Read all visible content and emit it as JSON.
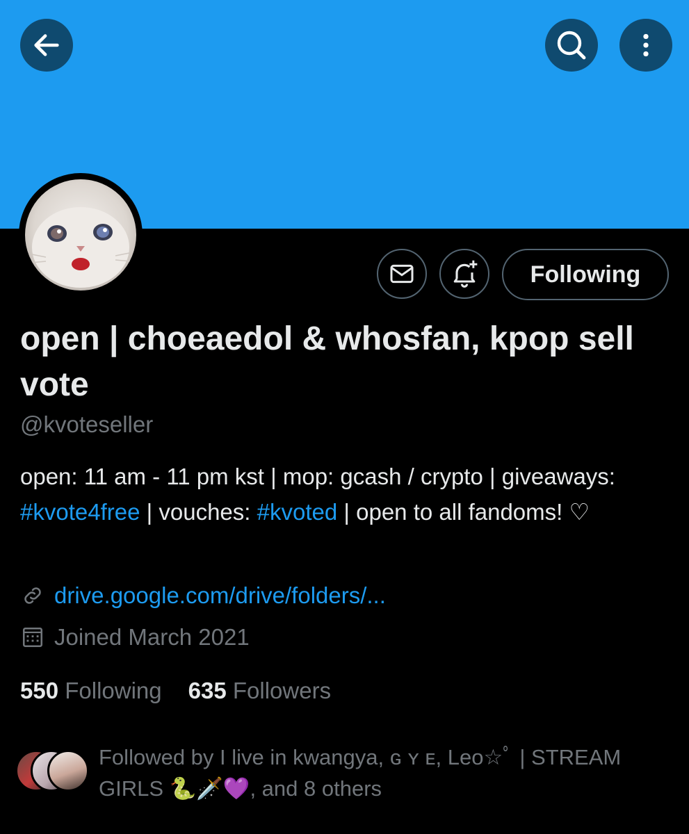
{
  "header": {
    "back_icon": "arrow-left-icon",
    "search_icon": "search-icon",
    "more_icon": "more-vertical-icon",
    "banner_color": "#1d9bf0"
  },
  "profile": {
    "name": "open | choeaedol & whosfan, kpop sell vote",
    "handle": "@kvoteseller",
    "bio": {
      "line_a": "open: 11 am - 11 pm kst | mop: gcash / crypto | giveaways: ",
      "hashtag_1": "#kvote4free",
      "mid": " | vouches: ",
      "hashtag_2": "#kvoted",
      "tail": " | open to all fandoms! ♡"
    },
    "link": "drive.google.com/drive/folders/...",
    "joined": "Joined March 2021"
  },
  "actions": {
    "message_icon": "envelope-icon",
    "notify_icon": "bell-plus-icon",
    "follow_label": "Following"
  },
  "stats": {
    "following_count": "550",
    "following_label": "Following",
    "followers_count": "635",
    "followers_label": "Followers"
  },
  "followed_by": {
    "text": "Followed by I live in kwangya, ɢ ʏ ᴇ, Leo☆ﾟ | STREAM GIRLS 🐍🗡️💜, and 8 others"
  },
  "colors": {
    "accent": "#1d9bf0",
    "text_primary": "#e7e9ea",
    "text_secondary": "#71767b",
    "background": "#000000"
  }
}
